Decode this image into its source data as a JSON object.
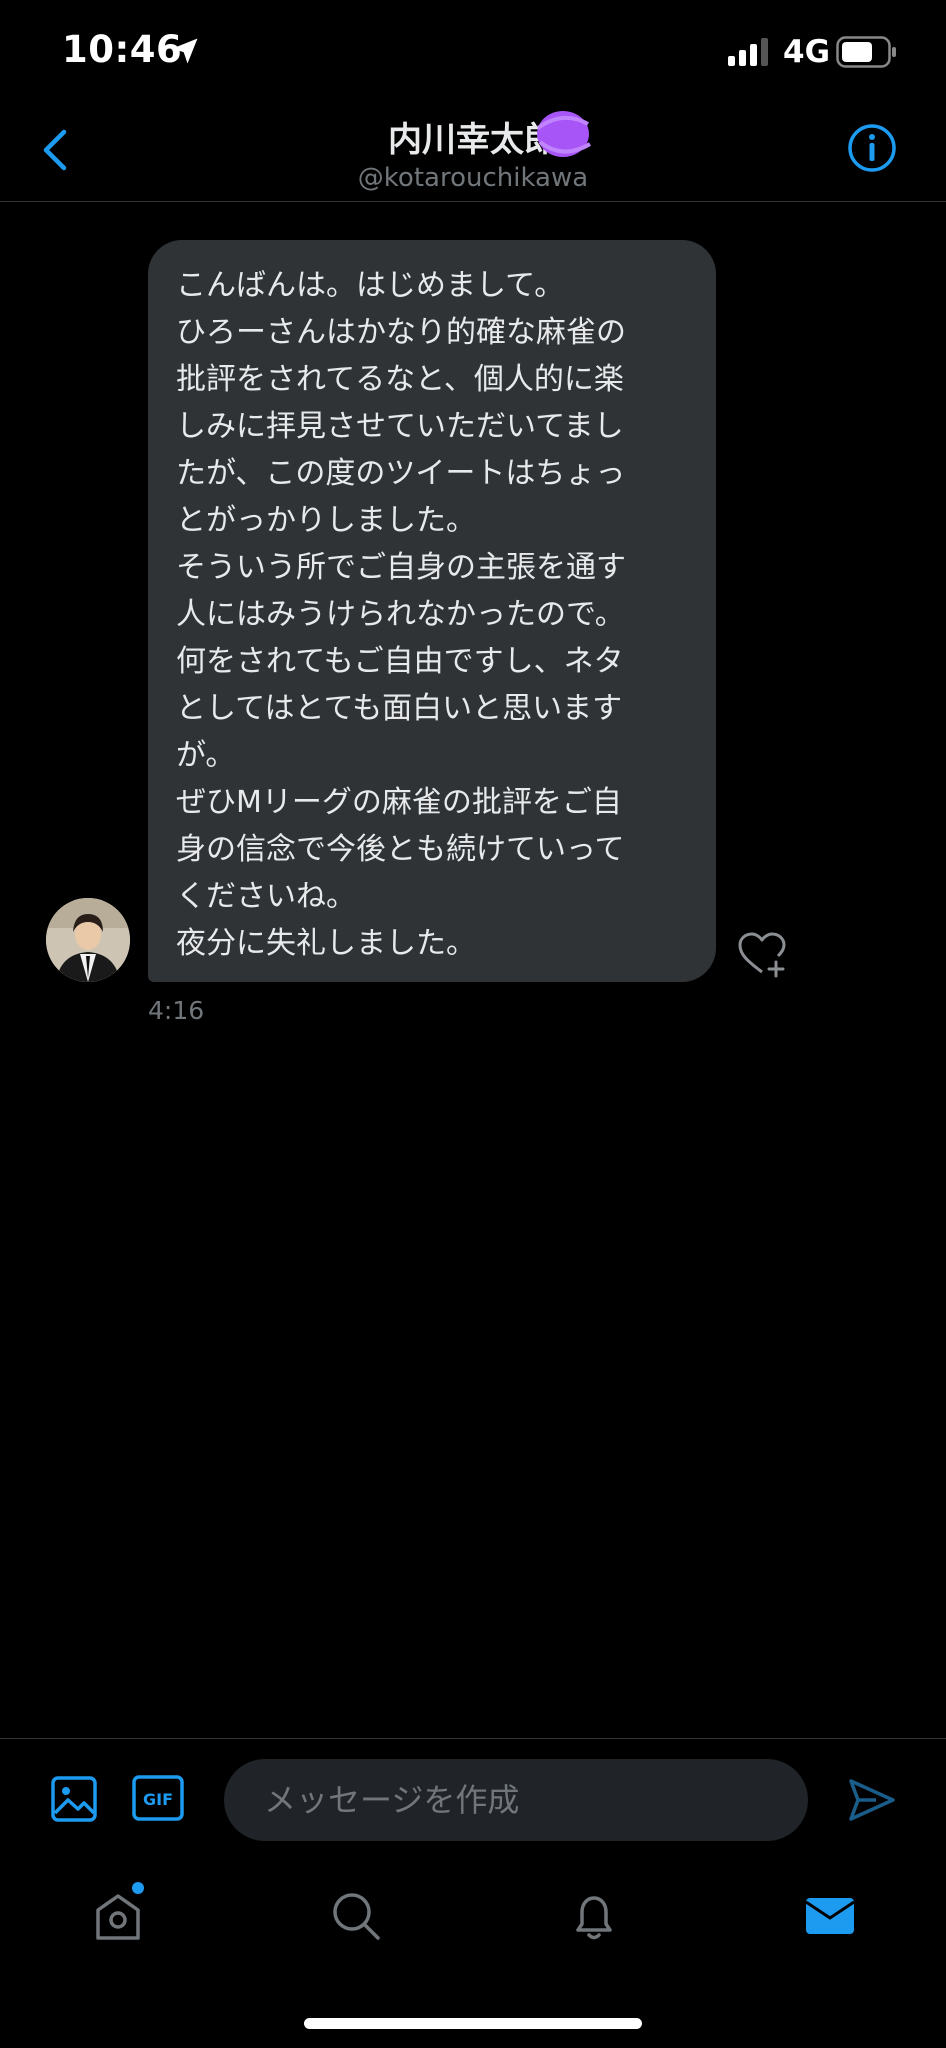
{
  "status_bar": {
    "time": "10:46",
    "network": "4G"
  },
  "header": {
    "title": "内川幸太郎",
    "handle": "@kotarouchikawa"
  },
  "message": {
    "lines": [
      "こんばんは。はじめまして。",
      "ひろーさんはかなり的確な麻雀の",
      "批評をされてるなと、個人的に楽",
      "しみに拝見させていただいてまし",
      "たが、この度のツイートはちょっ",
      "とがっかりしました。",
      "そういう所でご自身の主張を通す",
      "人にはみうけられなかったので。",
      "何をされてもご自由ですし、ネタ",
      "としてはとても面白いと思います",
      "が。",
      "ぜひMリーグの麻雀の批評をご自",
      "身の信念で今後とも続けていって",
      "くださいね。",
      "夜分に失礼しました。"
    ],
    "time": "4:16"
  },
  "composer": {
    "placeholder": "メッセージを作成"
  },
  "colors": {
    "accent": "#1d9bf0",
    "bubble": "#2f3336",
    "muted": "#71767b",
    "sticker": "#a855f7"
  },
  "icons": {
    "back": "chevron-left-icon",
    "info": "info-icon",
    "like": "heart-plus-icon",
    "image": "image-icon",
    "gif": "gif-icon",
    "send": "send-icon",
    "tabs": [
      "home-icon",
      "search-icon",
      "bell-icon",
      "mail-icon"
    ]
  }
}
